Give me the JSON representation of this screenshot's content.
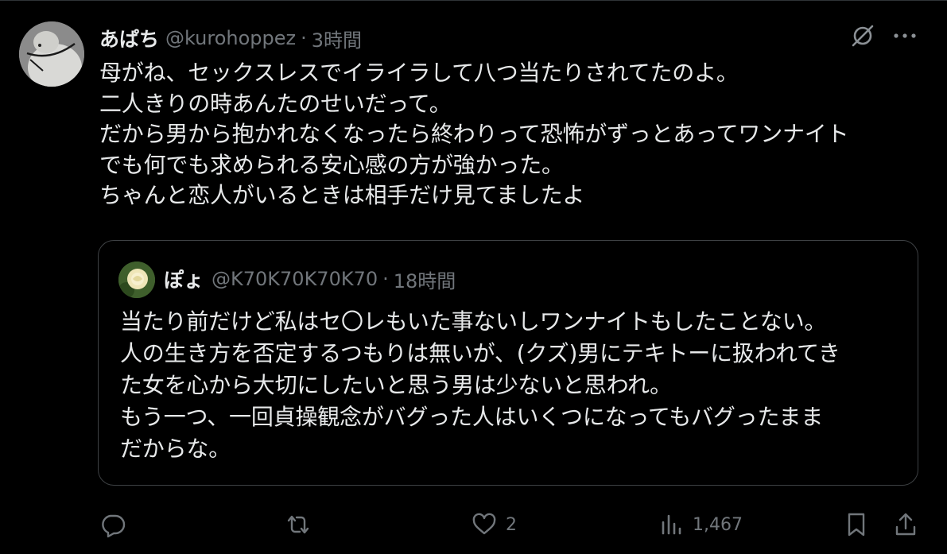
{
  "post": {
    "author_name": "あぱち",
    "author_handle": "@kurohoppez",
    "separator": "·",
    "time": "3時間",
    "body": "母がね、セックスレスでイライラして八つ当たりされてたのよ。\n二人きりの時あんたのせいだって。\nだから男から抱かれなくなったら終わりって恐怖がずっとあってワンナイト\nでも何でも求められる安心感の方が強かった。\nちゃんと恋人がいるときは相手だけ見てましたよ"
  },
  "quoted": {
    "author_name": "ぽょ",
    "author_handle": "@K70K70K70K70",
    "separator": "·",
    "time": "18時間",
    "body": "当たり前だけど私はセ〇レもいた事ないしワンナイトもしたことない。\n人の生き方を否定するつもりは無いが、(クズ)男にテキトーに扱われてき\nた女を心から大切にしたいと思う男は少ないと思われ。\nもう一つ、一回貞操観念がバグった人はいくつになってもバグったまま\nだからな。"
  },
  "actions": {
    "reply_count": "",
    "repost_count": "",
    "like_count": "2",
    "views_count": "1,467"
  },
  "icons": {
    "top": [
      "grok-icon",
      "more-icon"
    ],
    "actions": [
      "reply-icon",
      "repost-icon",
      "like-icon",
      "views-icon",
      "bookmark-icon",
      "share-icon"
    ]
  },
  "colors": {
    "background": "#000000",
    "text_primary": "#e7e9ea",
    "text_secondary": "#71767b",
    "border": "#3e4144"
  }
}
